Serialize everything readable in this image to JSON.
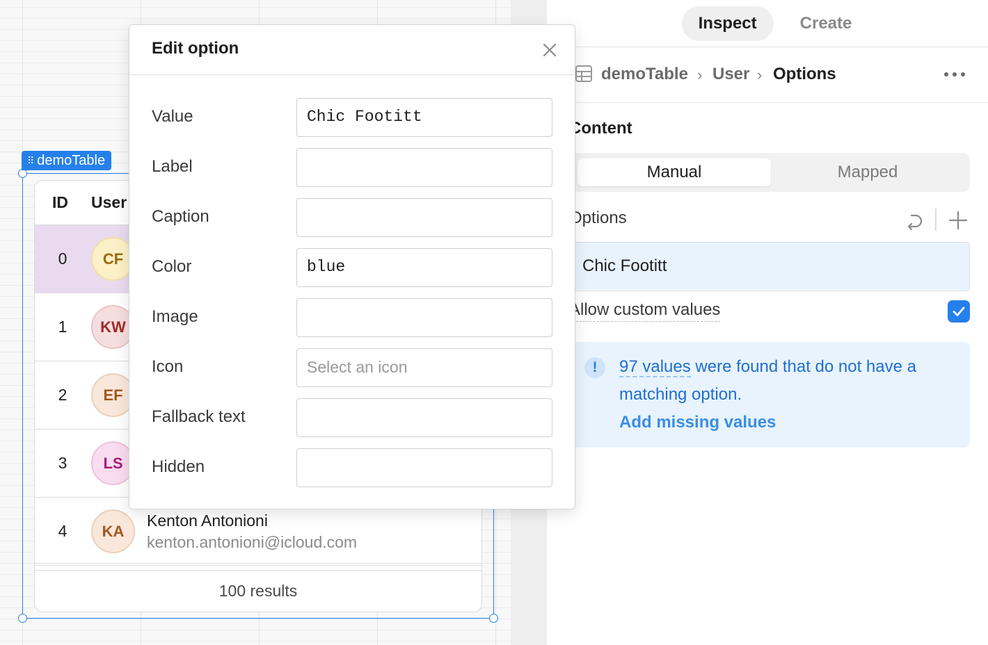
{
  "canvas": {
    "component_tag": "demoTable",
    "table": {
      "columns": [
        "ID",
        "User"
      ],
      "rows": [
        {
          "id": "0",
          "initials": "CF",
          "name": "",
          "email": "",
          "avatar_bg": "#fbf0c7",
          "avatar_border": "#f1dfa0",
          "avatar_fg": "#9a6a0a",
          "selected": true
        },
        {
          "id": "1",
          "initials": "KW",
          "name": "",
          "email": "",
          "avatar_bg": "#f7dede",
          "avatar_border": "#ecc2c2",
          "avatar_fg": "#a12a2a",
          "selected": false
        },
        {
          "id": "2",
          "initials": "EF",
          "name": "",
          "email": "",
          "avatar_bg": "#f8e7da",
          "avatar_border": "#ecd0ba",
          "avatar_fg": "#a2581e",
          "selected": false
        },
        {
          "id": "3",
          "initials": "LS",
          "name": "",
          "email": "",
          "avatar_bg": "#f9dcef",
          "avatar_border": "#efc0df",
          "avatar_fg": "#a51f78",
          "selected": false
        },
        {
          "id": "4",
          "initials": "KA",
          "name": "Kenton Antonioni",
          "email": "kenton.antonioni@icloud.com",
          "avatar_bg": "#f8e7da",
          "avatar_border": "#ecd0ba",
          "avatar_fg": "#a2581e",
          "selected": false
        }
      ],
      "footer": "100 results"
    }
  },
  "panel": {
    "tabs": [
      {
        "label": "Inspect",
        "active": true
      },
      {
        "label": "Create",
        "active": false
      }
    ],
    "breadcrumb": {
      "items": [
        "demoTable",
        "User",
        "Options"
      ],
      "separator": "›"
    },
    "content_title": "Content",
    "segmented": {
      "options": [
        "Manual",
        "Mapped"
      ],
      "active": "Manual"
    },
    "options_label": "Options",
    "options": [
      "Chic Footitt"
    ],
    "allow_custom_label": "Allow custom values",
    "allow_custom_checked": true,
    "info": {
      "icon": "!",
      "count_text": "97 values",
      "message_rest": " were found that do not have a matching option.",
      "action": "Add missing values"
    }
  },
  "modal": {
    "title": "Edit option",
    "fields": [
      {
        "label": "Value",
        "value": "Chic Footitt",
        "placeholder": ""
      },
      {
        "label": "Label",
        "value": "",
        "placeholder": ""
      },
      {
        "label": "Caption",
        "value": "",
        "placeholder": ""
      },
      {
        "label": "Color",
        "value": "blue",
        "placeholder": ""
      },
      {
        "label": "Image",
        "value": "",
        "placeholder": ""
      },
      {
        "label": "Icon",
        "value": "",
        "placeholder": "Select an icon"
      },
      {
        "label": "Fallback text",
        "value": "",
        "placeholder": ""
      },
      {
        "label": "Hidden",
        "value": "",
        "placeholder": ""
      }
    ]
  },
  "colors": {
    "accent": "#2680eb",
    "selected_row": "#eadaf0",
    "info_bg": "#e8f3fd"
  }
}
